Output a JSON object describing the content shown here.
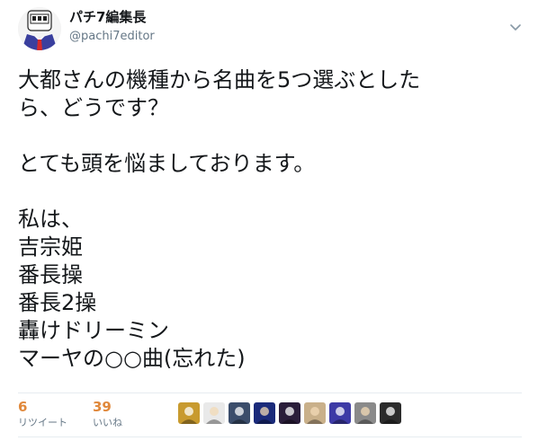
{
  "author": {
    "display_name": "パチ7編集長",
    "handle": "@pachi7editor",
    "avatar_icon": "editor-avatar-icon"
  },
  "tweet": {
    "text": "大都さんの機種から名曲を5つ選ぶとした\nら、どうです？\n\nとても頭を悩ましております。\n\n私は、\n吉宗姫\n番長操\n番長2操\n轟けドリーミン\nマーヤの○○曲(忘れた)"
  },
  "stats": {
    "retweets": {
      "count": "6",
      "label": "リツイート"
    },
    "likes": {
      "count": "39",
      "label": "いいね"
    }
  },
  "likers": [
    {
      "icon": "liker-avatar-1-icon",
      "color": "#c89a2e"
    },
    {
      "icon": "liker-avatar-2-icon",
      "color": "#e9e9e9"
    },
    {
      "icon": "liker-avatar-3-icon",
      "color": "#3b4d6b"
    },
    {
      "icon": "liker-avatar-4-icon",
      "color": "#1a2a7a"
    },
    {
      "icon": "liker-avatar-5-icon",
      "color": "#2a1d3a"
    },
    {
      "icon": "liker-avatar-6-icon",
      "color": "#c9b08a"
    },
    {
      "icon": "liker-avatar-7-icon",
      "color": "#3d3aa6"
    },
    {
      "icon": "liker-avatar-8-icon",
      "color": "#8a8a8a"
    },
    {
      "icon": "liker-avatar-9-icon",
      "color": "#2b2b2b"
    }
  ],
  "colors": {
    "stat_number": "#e0883b",
    "secondary_text": "#657786",
    "divider": "#e6ecf0"
  }
}
